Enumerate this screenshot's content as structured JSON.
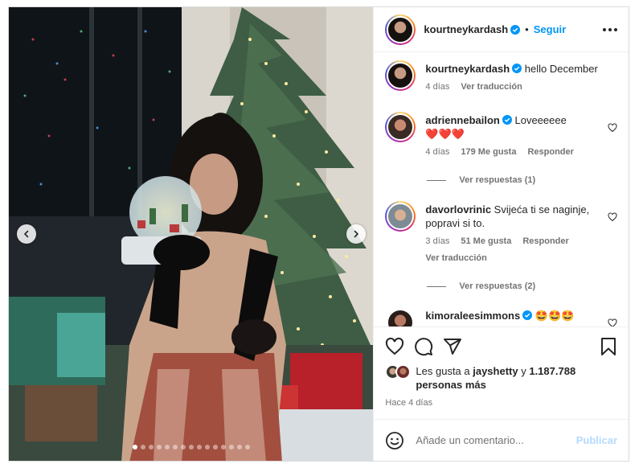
{
  "post": {
    "author": "kourtneykardash",
    "follow_label": "Seguir",
    "caption": "hello December",
    "caption_age": "4 días",
    "caption_translate": "Ver traducción"
  },
  "comments": [
    {
      "user": "adriennebailon",
      "text": "Loveeeeee",
      "extra": "❤️❤️❤️",
      "age": "4 días",
      "likes": "179 Me gusta",
      "reply": "Responder",
      "view_replies": "Ver respuestas (1)"
    },
    {
      "user": "davorlovrinic",
      "text": "Svijeća ti se naginje, popravi si to.",
      "age": "3 días",
      "likes": "51 Me gusta",
      "reply": "Responder",
      "translate": "Ver traducción",
      "view_replies": "Ver respuestas (2)"
    },
    {
      "user": "kimoraleesimmons",
      "text": "🤩🤩🤩"
    }
  ],
  "likes": {
    "prefix": "Les gusta a ",
    "user": "jayshetty",
    "middle": " y ",
    "count": "1.187.788 personas más"
  },
  "time_ago": "Hace 4 días",
  "add_comment": {
    "placeholder": "Añade un comentario...",
    "publish": "Publicar"
  },
  "carousel": {
    "total": 15,
    "active_index": 0
  },
  "colors": {
    "accent": "#0095f6",
    "verified": "#0095f6",
    "text": "#262626",
    "secondary": "#737373"
  },
  "icons": [
    "verified-icon",
    "more-icon",
    "heart-icon",
    "comment-icon",
    "share-icon",
    "bookmark-icon",
    "emoji-icon",
    "chevron-left-icon",
    "chevron-right-icon"
  ]
}
